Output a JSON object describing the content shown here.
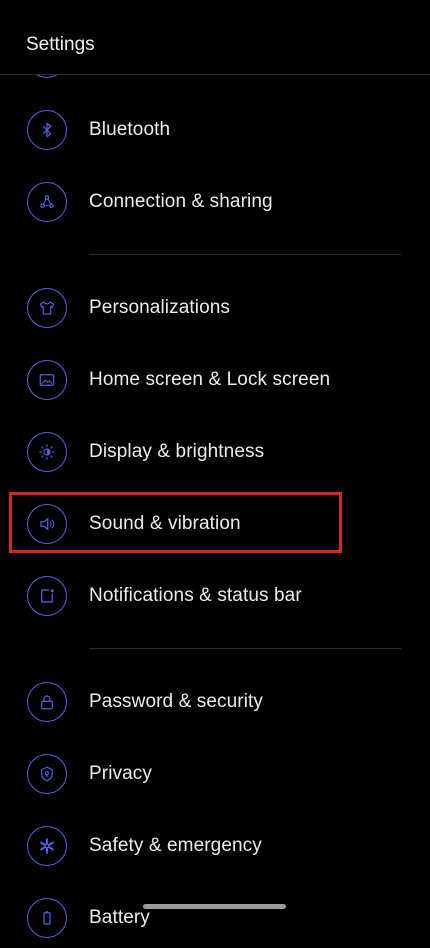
{
  "header": {
    "title": "Settings"
  },
  "items": [
    {
      "id": "bluetooth",
      "label": "Bluetooth",
      "icon": "bluetooth-icon"
    },
    {
      "id": "connection",
      "label": "Connection & sharing",
      "icon": "connection-sharing-icon"
    },
    {
      "id": "personalizations",
      "label": "Personalizations",
      "icon": "tshirt-icon"
    },
    {
      "id": "homescreen",
      "label": "Home screen & Lock screen",
      "icon": "image-frame-icon"
    },
    {
      "id": "display",
      "label": "Display & brightness",
      "icon": "brightness-icon"
    },
    {
      "id": "sound",
      "label": "Sound & vibration",
      "icon": "speaker-icon"
    },
    {
      "id": "notifications",
      "label": "Notifications & status bar",
      "icon": "notification-badge-icon"
    },
    {
      "id": "password",
      "label": "Password & security",
      "icon": "lock-icon"
    },
    {
      "id": "privacy",
      "label": "Privacy",
      "icon": "shield-icon"
    },
    {
      "id": "safety",
      "label": "Safety & emergency",
      "icon": "asterisk-icon"
    },
    {
      "id": "battery",
      "label": "Battery",
      "icon": "battery-icon"
    }
  ],
  "colors": {
    "accent": "#5b5fe0",
    "highlight": "#d6262d",
    "background": "#000000"
  }
}
